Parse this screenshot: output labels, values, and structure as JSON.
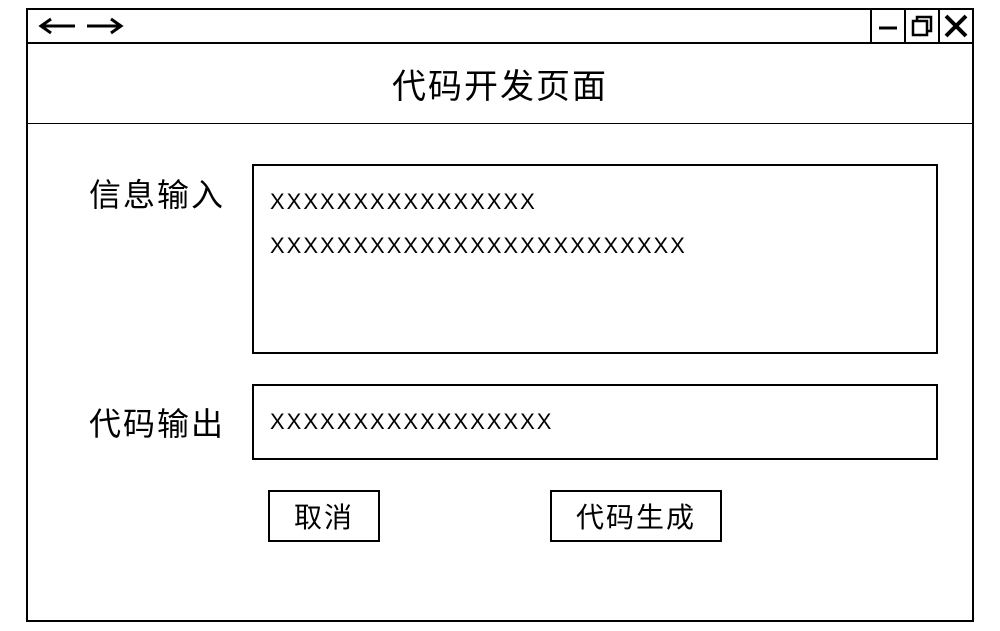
{
  "header": {
    "title": "代码开发页面"
  },
  "form": {
    "input_label": "信息输入",
    "input_value": "XXXXXXXXXXXXXXXX\nXXXXXXXXXXXXXXXXXXXXXXXXX",
    "output_label": "代码输出",
    "output_value": "XXXXXXXXXXXXXXXXX"
  },
  "buttons": {
    "cancel": "取消",
    "generate": "代码生成"
  },
  "window_controls": {
    "back": "back",
    "forward": "forward",
    "minimize": "minimize",
    "maximize": "maximize",
    "close": "close"
  }
}
